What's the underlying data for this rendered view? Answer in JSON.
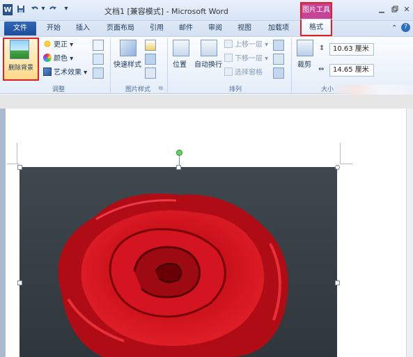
{
  "titlebar": {
    "word_logo": "W",
    "document_title": "文档1 [兼容模式] - Microsoft Word",
    "context_tool_label": "图片工具",
    "icons": [
      "save-icon",
      "undo-icon",
      "redo-icon",
      "customize-qat-icon",
      "minimize-icon",
      "restore-icon",
      "close-icon"
    ]
  },
  "tabs": {
    "file": "文件",
    "items": [
      "开始",
      "插入",
      "页面布局",
      "引用",
      "邮件",
      "审阅",
      "视图",
      "加载项"
    ],
    "active_context": "格式"
  },
  "ribbon": {
    "adjust": {
      "group_label": "调整",
      "remove_background": "删除背景",
      "corrections": "更正",
      "color": "颜色",
      "artistic_effects": "艺术效果"
    },
    "picture_styles": {
      "group_label": "图片样式",
      "quick_styles": "快速样式"
    },
    "arrange": {
      "group_label": "排列",
      "position": "位置",
      "wrap_text": "自动换行",
      "bring_forward": "上移一层",
      "send_backward": "下移一层",
      "selection_pane": "选择窗格"
    },
    "size": {
      "group_label": "大小",
      "crop": "裁剪",
      "height_value": "10.63 厘米",
      "width_value": "14.65 厘米"
    }
  },
  "colors": {
    "file_tab": "#1e4e9a",
    "picture_tools": "#c64496",
    "highlight_border": "#e02020",
    "rose": "#c8101a"
  }
}
